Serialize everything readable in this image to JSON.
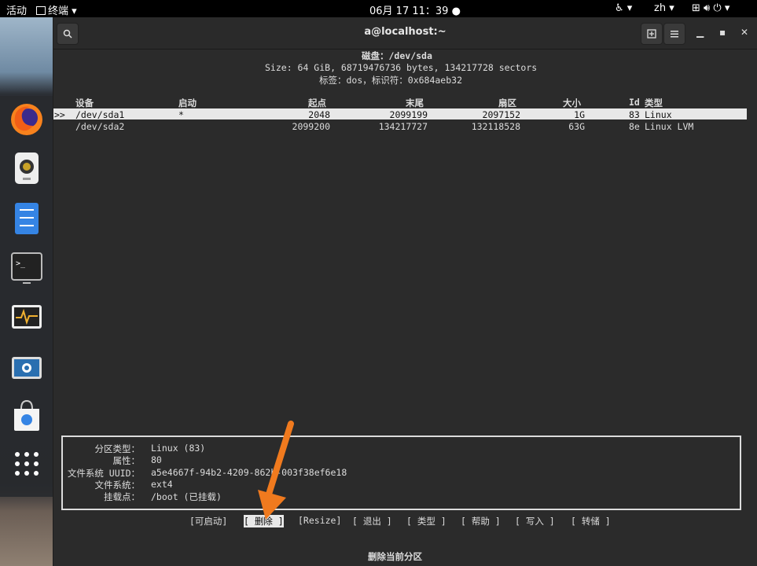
{
  "topbar": {
    "activities": "活动",
    "app_menu": "终端",
    "clock": "06月 17  11：39",
    "lang": "zh"
  },
  "window": {
    "title": "a@localhost:~"
  },
  "fdisk": {
    "disk_line": "磁盘：/dev/sda",
    "size_line": "Size: 64 GiB, 68719476736 bytes, 134217728 sectors",
    "label_line": "标签：dos，标识符：0x684aeb32",
    "headers": {
      "device": "设备",
      "boot": "启动",
      "start": "起点",
      "end": "末尾",
      "sectors": "扇区",
      "size": "大小",
      "id": "Id",
      "type": "类型"
    },
    "rows": [
      {
        "marker": ">>",
        "device": "/dev/sda1",
        "boot": "*",
        "start": "2048",
        "end": "2099199",
        "sectors": "2097152",
        "size": "1G",
        "id": "83",
        "type": "Linux"
      },
      {
        "marker": "",
        "device": "/dev/sda2",
        "boot": "",
        "start": "2099200",
        "end": "134217727",
        "sectors": "132118528",
        "size": "63G",
        "id": "8e",
        "type": "Linux LVM"
      }
    ],
    "info": {
      "labels": [
        "分区类型：",
        "属性：",
        "文件系统 UUID：",
        "文件系统：",
        "挂载点："
      ],
      "values": [
        "Linux (83)",
        "80",
        "a5e4667f-94b2-4209-862b-003f38ef6e18",
        "ext4",
        "/boot (已挂载)"
      ]
    },
    "menu": [
      "[可启动]",
      "[ 删除 ]",
      "[Resize]",
      "[ 退出 ]",
      "[ 类型 ]",
      "[ 帮助 ]",
      "[ 写入 ]",
      "[ 转储 ]"
    ],
    "status": "删除当前分区"
  },
  "colors": {
    "annotation_arrow": "#f07a1e",
    "terminal_bg": "#2b2b2b"
  }
}
